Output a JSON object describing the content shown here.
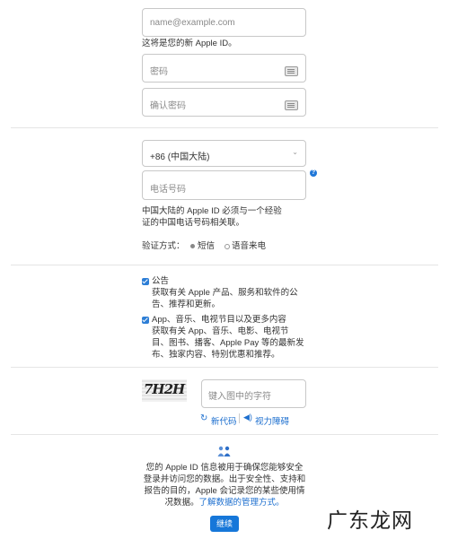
{
  "email": {
    "placeholder": "name@example.com",
    "hint": "这将是您的新 Apple ID。"
  },
  "password": {
    "placeholder": "密码"
  },
  "confirm_password": {
    "placeholder": "确认密码"
  },
  "phone": {
    "country_value": "+86 (中国大陆)",
    "placeholder": "电话号码",
    "help_mark": "?",
    "note_line1": "中国大陆的 Apple ID 必须与一个经验",
    "note_line2": "证的中国电话号码相关联。"
  },
  "verify": {
    "label": "验证方式：",
    "option_sms": "短信",
    "option_voice": "语音来电"
  },
  "subscriptions": [
    {
      "title": "公告",
      "desc_lines": [
        "获取有关 Apple 产品、服务和软件的公",
        "告、推荐和更新。"
      ]
    },
    {
      "title": "App、音乐、电视节目以及更多内容",
      "desc_lines": [
        "获取有关 App、音乐、电影、电视节",
        "目、图书、播客、Apple Pay 等的最新发",
        "布、独家内容、特别优惠和推荐。"
      ]
    }
  ],
  "captcha": {
    "image_text": "7H2H",
    "placeholder": "键入图中的字符",
    "new_code": "新代码",
    "audio": "视力障碍"
  },
  "privacy": {
    "lines": [
      "您的 Apple ID 信息被用于确保您能够安全",
      "登录并访问您的数据。出于安全性、支持和",
      "报告的目的，Apple 会记录您的某些使用情"
    ],
    "last_prefix": "况数据。",
    "link": "了解数据的管理方式。"
  },
  "continue_button": "继续",
  "watermark": "广东龙网",
  "colors": {
    "accent": "#1677d9",
    "link": "#1d6fcf",
    "border": "#c8c8c8"
  }
}
